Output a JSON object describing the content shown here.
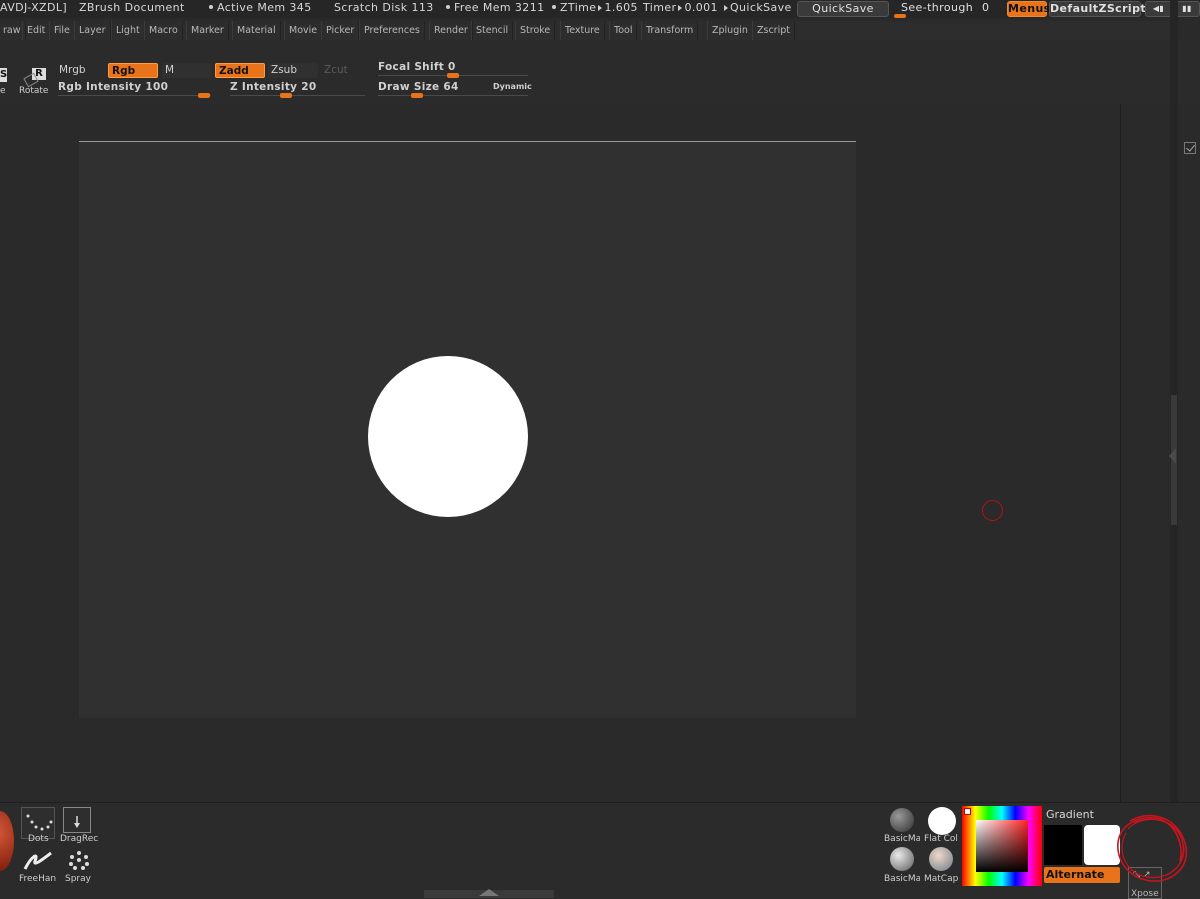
{
  "titlebar": {
    "doc_id": "AVDJ-XZDL]",
    "app_title": "ZBrush Document",
    "active_mem": "Active Mem 345",
    "scratch_disk": "Scratch Disk 113",
    "free_mem": "Free Mem 3211",
    "ztime": "ZTime",
    "ztime_value": "1.605",
    "timer": "Timer",
    "timer_value": "0.001",
    "quicksave_text": "QuickSave",
    "quicksave_button": "QuickSave",
    "seethrough_label": "See-through",
    "seethrough_value": "0",
    "menus_button": "Menus",
    "zscript_button": "DefaultZScript"
  },
  "menubar": {
    "items": [
      "raw",
      "Edit",
      "File",
      "Layer",
      "Light",
      "Macro",
      "Marker",
      "Material",
      "Movie",
      "Picker",
      "Preferences",
      "Render",
      "Stencil",
      "Stroke",
      "Texture",
      "Tool",
      "Transform",
      "Zplugin",
      "Zscript"
    ]
  },
  "shelf": {
    "left_label_s": "S",
    "left_label_e": "e",
    "rotate_label": "Rotate",
    "rotate_key": "R",
    "mrgb": "Mrgb",
    "rgb": "Rgb",
    "m": "M",
    "zadd": "Zadd",
    "zsub": "Zsub",
    "zcut": "Zcut",
    "rgb_intensity_label": "Rgb Intensity",
    "rgb_intensity_value": "100",
    "z_intensity_label": "Z Intensity",
    "z_intensity_value": "20",
    "focal_shift_label": "Focal Shift",
    "focal_shift_value": "0",
    "draw_size_label": "Draw Size",
    "draw_size_value": "64",
    "dynamic_label": "Dynamic"
  },
  "bottom": {
    "dots_label": "Dots",
    "dragrect_label": "DragRec",
    "freehand_label": "FreeHan",
    "spray_label": "Spray",
    "basicmat1_label": "BasicMa",
    "flatcolor_label": "Flat Col",
    "basicmat2_label": "BasicMa",
    "matcap_label": "MatCap",
    "gradient_label": "Gradient",
    "alternate_label": "Alternate",
    "xpose_label": "Xpose"
  },
  "colors": {
    "accent": "#e8731a",
    "background": "#2a2a2a",
    "document": "#303030",
    "cursor": "#b01515"
  }
}
